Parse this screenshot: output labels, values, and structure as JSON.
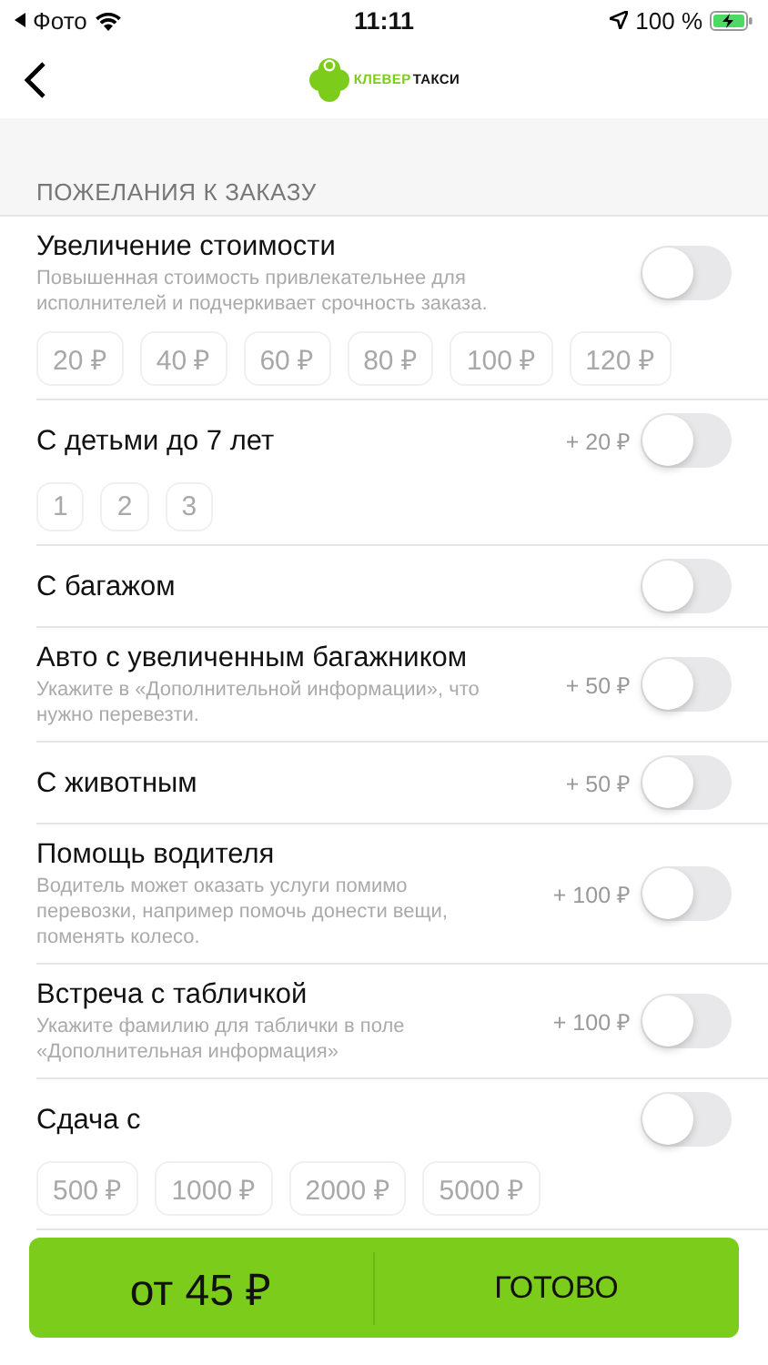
{
  "status_bar": {
    "back_app": "Фото",
    "time": "11:11",
    "battery": "100 %"
  },
  "nav": {
    "logo": {
      "word_1": "КЛЕВЕР",
      "word_2": "ТАКСИ"
    }
  },
  "section": {
    "title": "ПОЖЕЛАНИЯ К ЗАКАЗУ"
  },
  "options": [
    {
      "title": "Увеличение стоимости",
      "description": "Повышенная стоимость привлекательнее для исполнителей и подчеркивает срочность заказа.",
      "on": false,
      "chips": [
        {
          "label": "20 ₽",
          "selected": false
        },
        {
          "label": "40 ₽",
          "selected": false
        },
        {
          "label": "60 ₽",
          "selected": false
        },
        {
          "label": "80 ₽",
          "selected": false
        },
        {
          "label": "100 ₽",
          "selected": false
        },
        {
          "label": "120 ₽",
          "selected": false
        }
      ]
    },
    {
      "title": "С детьми до 7 лет",
      "price": "+ 20 ₽",
      "on": false,
      "chips": [
        {
          "label": "1",
          "selected": false
        },
        {
          "label": "2",
          "selected": false
        },
        {
          "label": "3",
          "selected": false
        }
      ]
    },
    {
      "title": "С багажом",
      "on": false
    },
    {
      "title": "Авто с увеличенным багажником",
      "description": "Укажите в «Дополнительной информации», что нужно перевезти.",
      "price": "+ 50 ₽",
      "on": false
    },
    {
      "title": "С животным",
      "price": "+ 50 ₽",
      "on": false
    },
    {
      "title": "Помощь водителя",
      "description": "Водитель может оказать услуги помимо перевозки, например помочь донести вещи, поменять колесо.",
      "price": "+ 100 ₽",
      "on": false
    },
    {
      "title": "Встреча с табличкой",
      "description": "Укажите фамилию для таблички в поле «Дополнительная информация»",
      "price": "+ 100 ₽",
      "on": false
    },
    {
      "title": "Сдача с",
      "on": false,
      "chips": [
        {
          "label": "500 ₽",
          "selected": false
        },
        {
          "label": "1000 ₽",
          "selected": false
        },
        {
          "label": "2000 ₽",
          "selected": false
        },
        {
          "label": "5000 ₽",
          "selected": false
        }
      ]
    }
  ],
  "bottom_bar": {
    "price": "от 45 ₽",
    "done": "ГОТОВО"
  }
}
